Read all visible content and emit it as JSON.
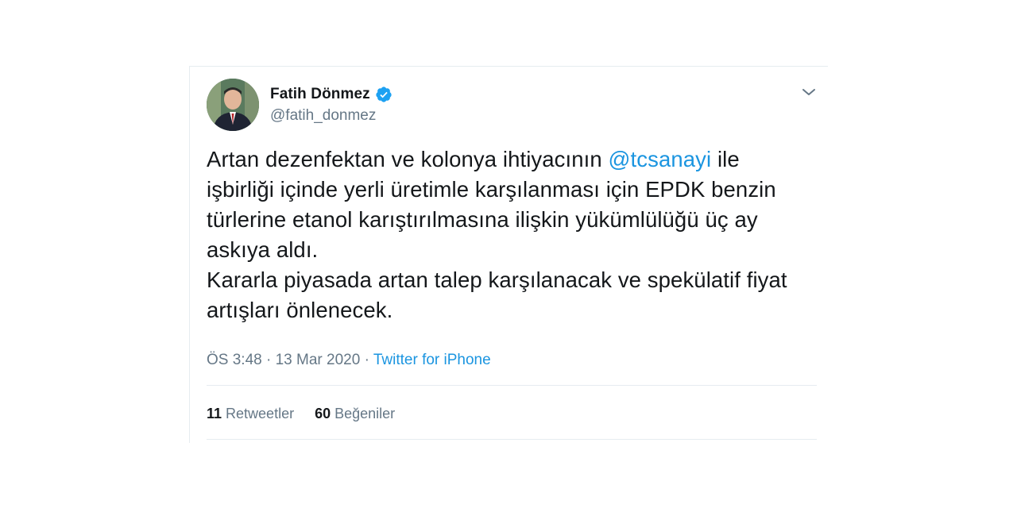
{
  "author": {
    "name": "Fatih Dönmez",
    "handle": "@fatih_donmez"
  },
  "tweet": {
    "line1_before": "Artan dezenfektan ve kolonya ihtiyacının ",
    "mention": "@tcsanayi",
    "line1_after": " ile işbirliği içinde yerli üretimle karşılanması için EPDK benzin türlerine etanol karıştırılmasına ilişkin yükümlülüğü üç ay askıya aldı.",
    "paragraph2": "Kararla piyasada artan talep karşılanacak ve spekülatif fiyat artışları önlenecek."
  },
  "meta": {
    "time": "ÖS 3:48",
    "date": "13 Mar 2020",
    "separator": " · ",
    "source": "Twitter for iPhone"
  },
  "stats": {
    "retweets_count": "11",
    "retweets_label": "Retweetler",
    "likes_count": "60",
    "likes_label": "Beğeniler"
  },
  "icons": {
    "verified": "verified-badge-icon",
    "menu": "chevron-down-icon"
  },
  "colors": {
    "link": "#1b95e0",
    "secondary_text": "#657786",
    "primary_text": "#14171a",
    "border": "#e6ecf0"
  }
}
